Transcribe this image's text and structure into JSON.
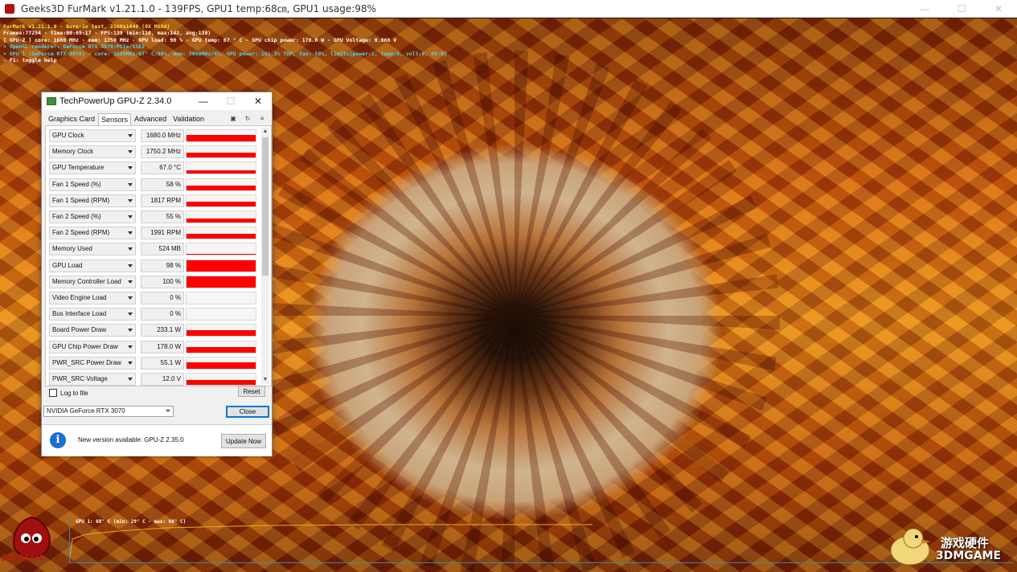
{
  "furmark": {
    "window_title": "Geeks3D FurMark v1.21.1.0 - 139FPS, GPU1 temp:68㎝, GPU1 usage:98%",
    "hud_lines": [
      {
        "text": "FurMark v1.21.1.0 - Burn-in test, 2560x1440 (8X MSAA)",
        "color": "y"
      },
      {
        "text": "Frames:77254 - time:00:09:17 - FPS:139 (min:110, max:142, avg:138)",
        "color": "w"
      },
      {
        "text": "[ GPU-Z ] core: 1680 MHz - mem: 1750 MHz - GPU load: 98 % - GPU temp: 67 ° C - GPU chip power: 178.0 W - GPU Voltage: 0.868 V",
        "color": "w"
      },
      {
        "text": "> OpenGL renderer: GeForce RTX 3070/PCIe/SSE2",
        "color": "c"
      },
      {
        "text": "> GPU 1 (GeForce RTX 3070) - core: 1680MHz/67° C/98%, mem: 7000MHz/6%, GPU power: 101.3% TDP, fan: 58%, limits[power:1, temp:0, volt:0, OV:0]",
        "color": "c"
      },
      {
        "text": "- F1: toggle help",
        "color": "w"
      }
    ],
    "graph_label": "GPU 1: 68° C (min: 29° C - max: 68° C)",
    "logo_text": "FurMark"
  },
  "gpuz": {
    "title": "TechPowerUp GPU-Z 2.34.0",
    "tabs": [
      "Graphics Card",
      "Sensors",
      "Advanced",
      "Validation"
    ],
    "active_tab": "Sensors",
    "sensors": [
      {
        "name": "GPU Clock",
        "value": "1680.0 MHz",
        "fill": 0.85
      },
      {
        "name": "Memory Clock",
        "value": "1750.2 MHz",
        "fill": 0.65
      },
      {
        "name": "GPU Temperature",
        "value": "67.0 °C",
        "fill": 0.45
      },
      {
        "name": "Fan 1 Speed (%)",
        "value": "58 %",
        "fill": 0.55
      },
      {
        "name": "Fan 1 Speed (RPM)",
        "value": "1817 RPM",
        "fill": 0.6
      },
      {
        "name": "Fan 2 Speed (%)",
        "value": "55 %",
        "fill": 0.55
      },
      {
        "name": "Fan 2 Speed (RPM)",
        "value": "1991 RPM",
        "fill": 0.6
      },
      {
        "name": "Memory Used",
        "value": "524 MB",
        "fill": 0.08
      },
      {
        "name": "GPU Load",
        "value": "98 %",
        "fill": 0.98
      },
      {
        "name": "Memory Controller Load",
        "value": "100 %",
        "fill": 1.0
      },
      {
        "name": "Video Engine Load",
        "value": "0 %",
        "fill": 0.0
      },
      {
        "name": "Bus Interface Load",
        "value": "0 %",
        "fill": 0.0
      },
      {
        "name": "Board Power Draw",
        "value": "233.1 W",
        "fill": 0.8
      },
      {
        "name": "GPU Chip Power Draw",
        "value": "178.0 W",
        "fill": 0.7
      },
      {
        "name": "PWR_SRC Power Draw",
        "value": "55.1 W",
        "fill": 0.75
      },
      {
        "name": "PWR_SRC Voltage",
        "value": "12.0 V",
        "fill": 0.6
      }
    ],
    "log_label": "Log to file",
    "reset_label": "Reset",
    "device_select": "NVIDIA GeForce RTX 3070",
    "close_label": "Close",
    "update_text": "New version available: GPU-Z 2.35.0",
    "update_button": "Update Now"
  },
  "watermark": {
    "cn": "游戏硬件",
    "en": "3DMGAME"
  },
  "colors": {
    "graph_fill": "#ff0000",
    "temp_line": "#f5a623",
    "info": "#1a6fd0"
  }
}
